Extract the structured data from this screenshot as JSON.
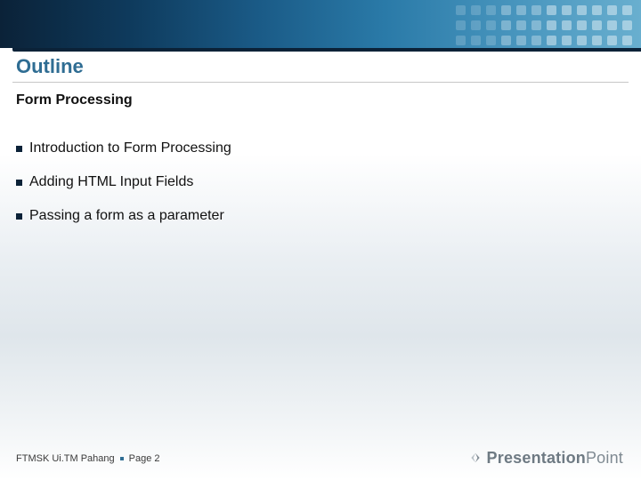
{
  "header": {
    "title": "Outline",
    "subtitle": "Form Processing"
  },
  "bullets": [
    "Introduction to Form Processing",
    "Adding HTML Input Fields",
    "Passing a form as a parameter"
  ],
  "footer": {
    "org": "FTMSK Ui.TM Pahang",
    "page_label": "Page 2"
  },
  "brand": {
    "part1": "Presentation",
    "part2": "Point"
  },
  "colors": {
    "accent": "#2f6d93",
    "dark": "#0b2238"
  }
}
